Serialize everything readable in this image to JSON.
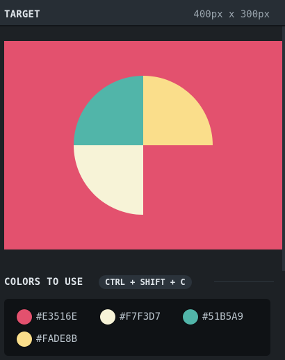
{
  "header": {
    "title": "TARGET",
    "size_label": "400px x 300px"
  },
  "target": {
    "background": "#E3516E",
    "quadrants": {
      "top_right": "#FADE8B",
      "top_left": "#51B5A9",
      "bottom_left": "#F7F3D7"
    }
  },
  "colors_section": {
    "label": "COLORS TO USE",
    "shortcut": "CTRL + SHIFT + C"
  },
  "colors": [
    {
      "hex": "#E3516E"
    },
    {
      "hex": "#F7F3D7"
    },
    {
      "hex": "#51B5A9"
    },
    {
      "hex": "#FADE8B"
    }
  ]
}
